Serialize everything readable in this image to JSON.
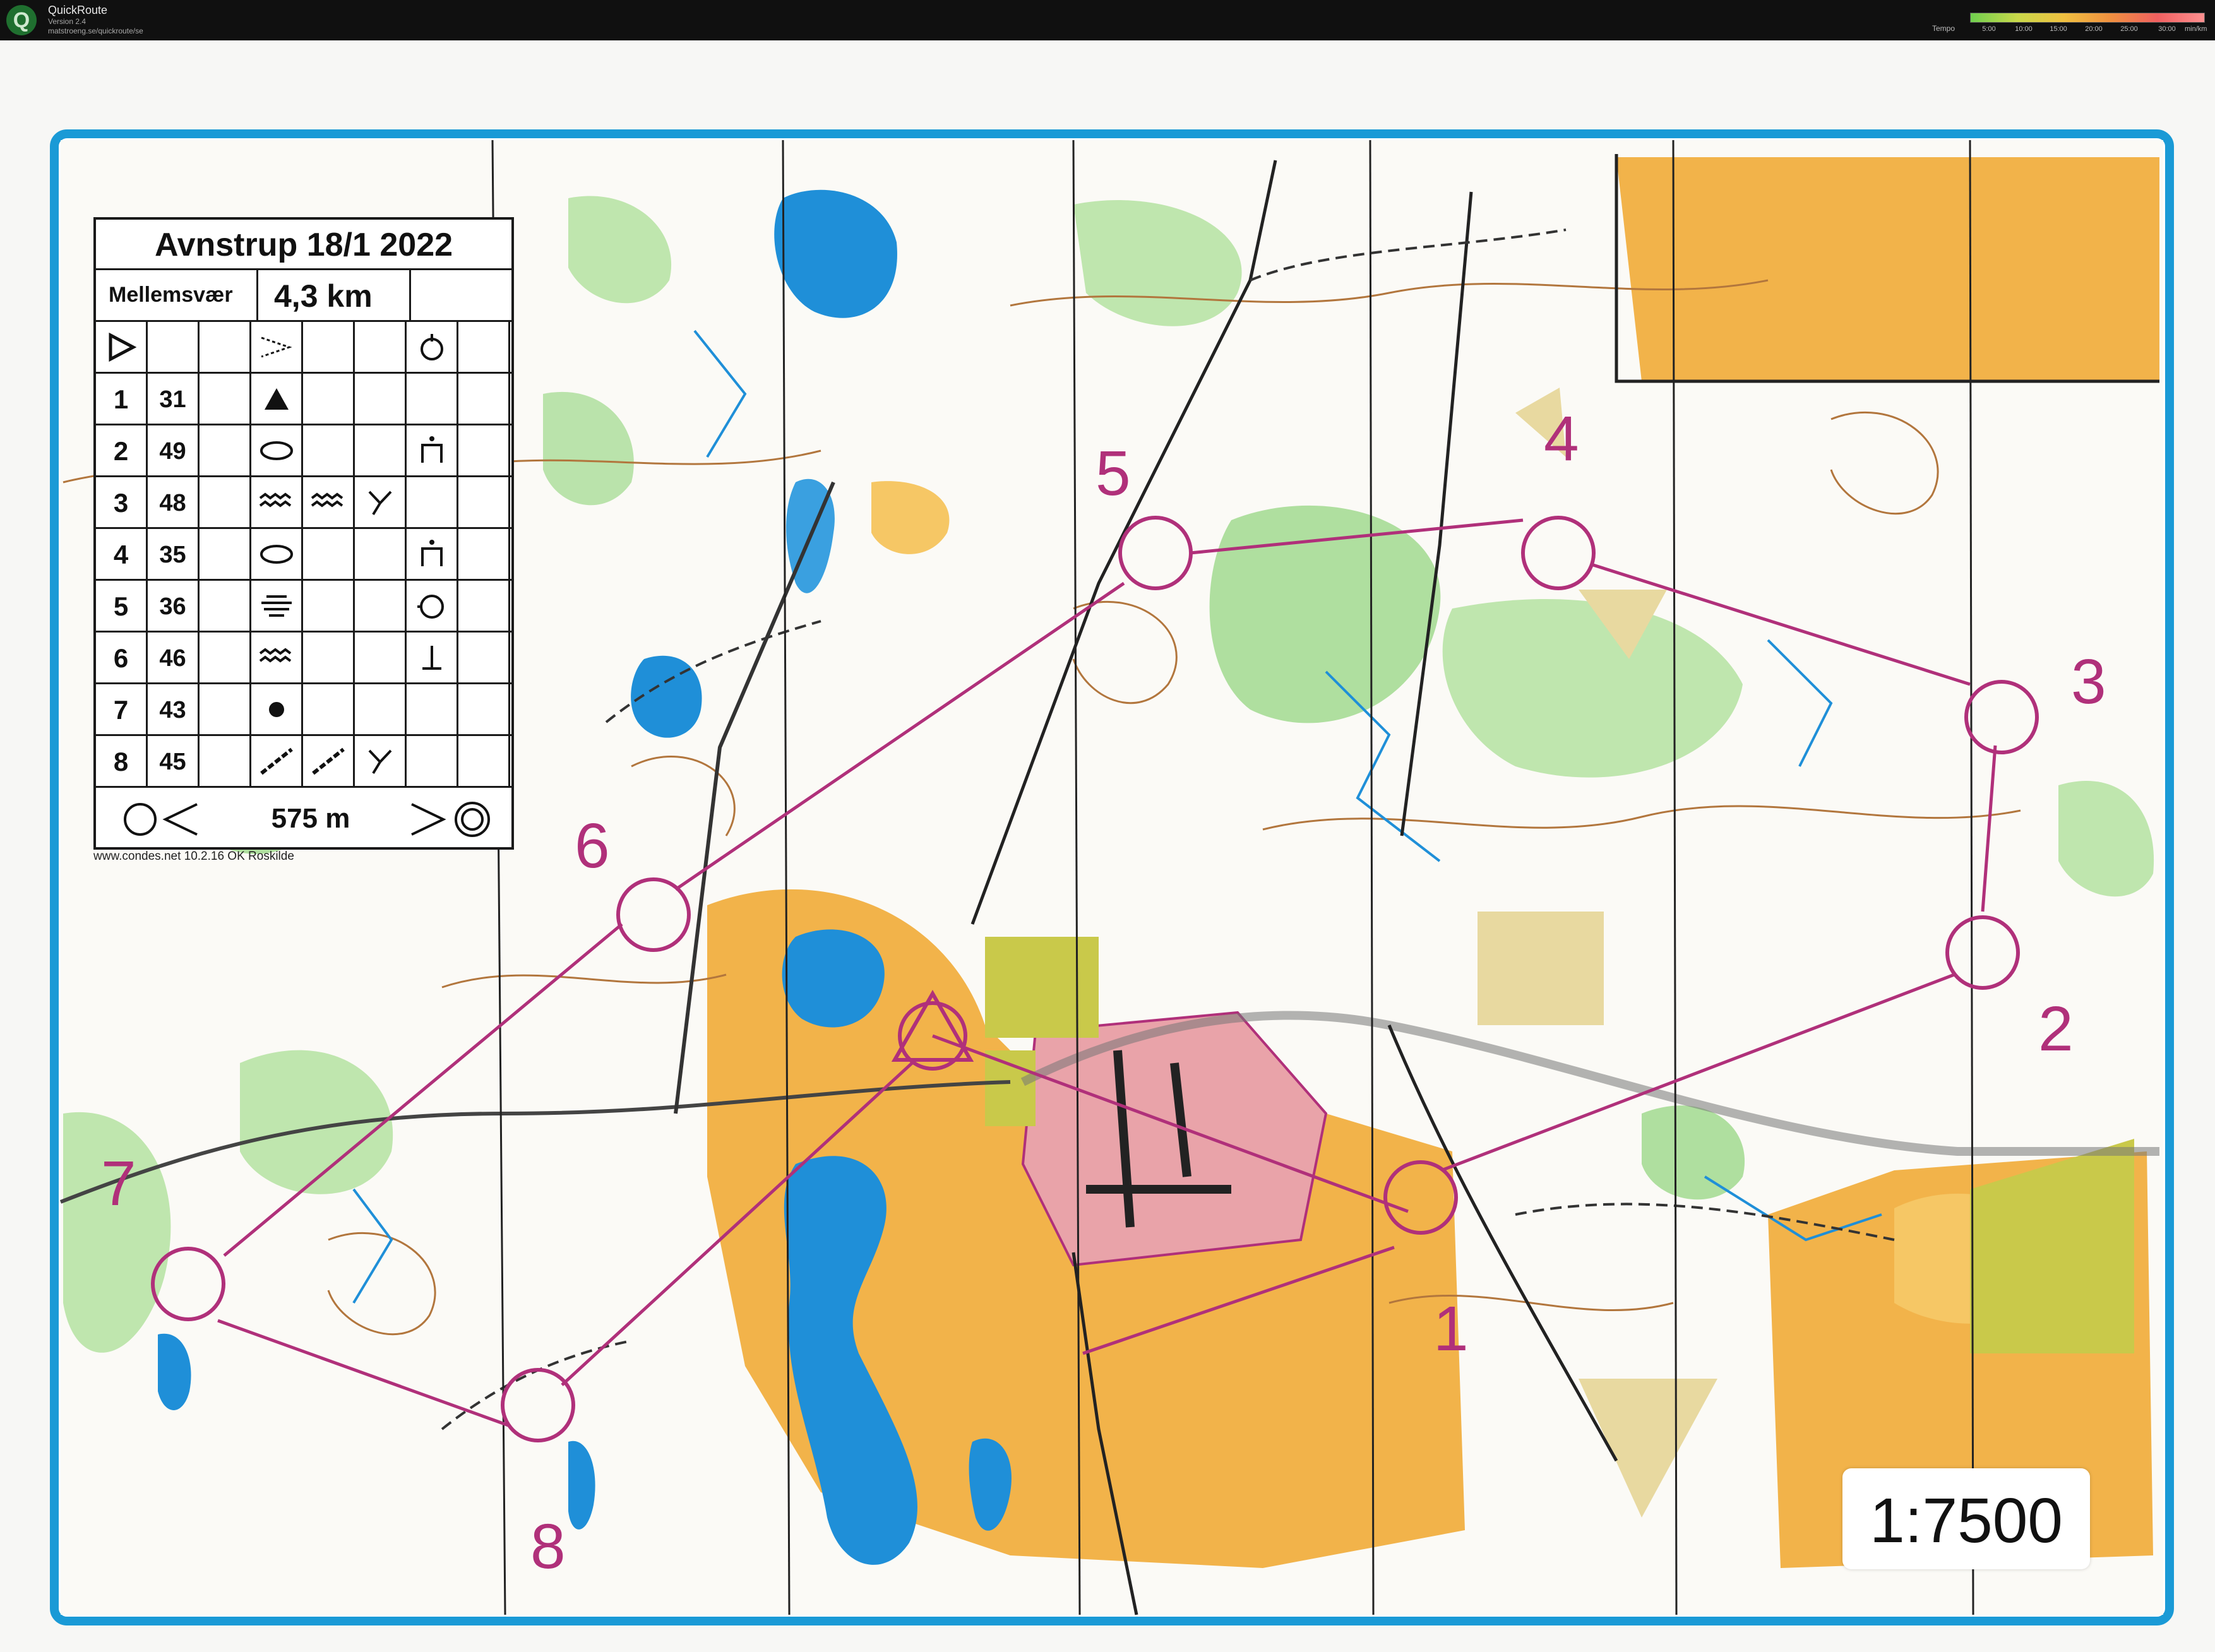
{
  "app": {
    "name": "QuickRoute",
    "version": "Version 2.4",
    "url": "matstroeng.se/quickroute/se",
    "logo_letter": "Q"
  },
  "tempo_legend": {
    "title": "Tempo",
    "ticks": [
      "5:00",
      "10:00",
      "15:00",
      "20:00",
      "25:00",
      "30:00"
    ],
    "unit": "min/km"
  },
  "control_card": {
    "title": "Avnstrup 18/1 2022",
    "class_name": "Mellemsvær",
    "length": "4,3 km",
    "rows": [
      {
        "num": "",
        "code": "",
        "symbols": [
          "start-triangle",
          "",
          "",
          "open-land-v",
          "",
          "",
          "tower-symbol",
          ""
        ]
      },
      {
        "num": "1",
        "code": "31",
        "symbols": [
          "",
          "",
          "",
          "triangle-filled",
          "",
          "",
          "",
          ""
        ]
      },
      {
        "num": "2",
        "code": "49",
        "symbols": [
          "",
          "",
          "",
          "ellipse-knoll",
          "",
          "",
          "foot-symbol",
          ""
        ]
      },
      {
        "num": "3",
        "code": "48",
        "symbols": [
          "",
          "",
          "",
          "marsh-zigzag",
          "marsh-zigzag",
          "junction-y",
          "",
          ""
        ]
      },
      {
        "num": "4",
        "code": "35",
        "symbols": [
          "",
          "",
          "",
          "ellipse-knoll",
          "",
          "",
          "foot-symbol",
          ""
        ]
      },
      {
        "num": "5",
        "code": "36",
        "symbols": [
          "",
          "",
          "",
          "marsh-lines",
          "",
          "",
          "circle-side",
          ""
        ]
      },
      {
        "num": "6",
        "code": "46",
        "symbols": [
          "",
          "",
          "",
          "marsh-zigzag",
          "",
          "",
          "t-symbol",
          ""
        ]
      },
      {
        "num": "7",
        "code": "43",
        "symbols": [
          "",
          "",
          "",
          "dot-filled",
          "",
          "",
          "",
          ""
        ]
      },
      {
        "num": "8",
        "code": "45",
        "symbols": [
          "",
          "",
          "",
          "ditch-line",
          "ditch-line",
          "junction-y",
          "",
          ""
        ]
      }
    ],
    "finish_distance": "575 m",
    "credit": "www.condes.net 10.2.16 OK Roskilde"
  },
  "controls": [
    {
      "label": "1"
    },
    {
      "label": "2"
    },
    {
      "label": "3"
    },
    {
      "label": "4"
    },
    {
      "label": "5"
    },
    {
      "label": "6"
    },
    {
      "label": "7"
    },
    {
      "label": "8"
    }
  ],
  "scale": "1:7500",
  "colors": {
    "course": "#b0307a",
    "frame": "#1a9ad6",
    "open_land": "#f2b34a",
    "forest_green": "#8fd37a",
    "water": "#1f8fd8",
    "contour": "#b2763d"
  }
}
